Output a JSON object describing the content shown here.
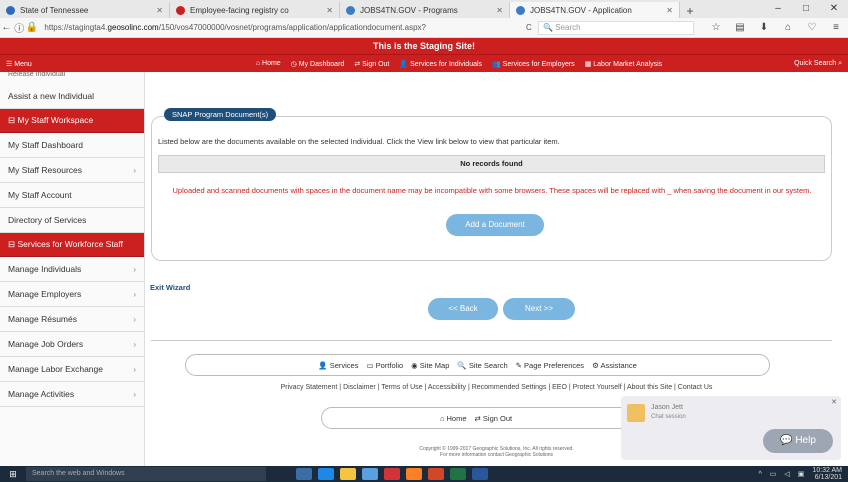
{
  "browser": {
    "tabs": [
      {
        "label": "State of Tennessee",
        "color": "#2d6db5",
        "active": false
      },
      {
        "label": "Employee-facing registry co",
        "color": "#cc1f1f",
        "active": false
      },
      {
        "label": "JOBS4TN.GOV - Programs",
        "color": "#3c7cc4",
        "active": false
      },
      {
        "label": "JOBS4TN.GOV - Application",
        "color": "#3c7cc4",
        "active": true
      }
    ],
    "new_tab": "+",
    "url_prefix": "https://stagingta4.",
    "url_domain": "geosolinc.com",
    "url_path": "/150/vos47000000/vosnet/programs/application/applicationdocument.aspx?",
    "search_placeholder": "Search"
  },
  "banner": {
    "staging_text": "This is the Staging Site!",
    "menu_label": "Menu",
    "nav": [
      "Home",
      "My Dashboard",
      "Sign Out",
      "Services for Individuals",
      "Services for Employers",
      "Labor Market Analysis"
    ],
    "quick_search": "Quick Search"
  },
  "sidebar": {
    "cut_item": "Release Individual",
    "items_top": [
      "Assist a new Individual"
    ],
    "head1": "My Staff Workspace",
    "items_mid": [
      {
        "label": "My Staff Dashboard",
        "chev": false
      },
      {
        "label": "My Staff Resources",
        "chev": true
      },
      {
        "label": "My Staff Account",
        "chev": false
      },
      {
        "label": "Directory of Services",
        "chev": false
      }
    ],
    "head2": "Services for Workforce Staff",
    "items_bottom": [
      {
        "label": "Manage Individuals",
        "chev": true
      },
      {
        "label": "Manage Employers",
        "chev": true
      },
      {
        "label": "Manage Résumés",
        "chev": true
      },
      {
        "label": "Manage Job Orders",
        "chev": true
      },
      {
        "label": "Manage Labor Exchange",
        "chev": true
      },
      {
        "label": "Manage Activities",
        "chev": true
      }
    ]
  },
  "main": {
    "panel_label": "SNAP Program Document(s)",
    "intro": "Listed below are the documents available on the selected Individual. Click the View link below to view that particular item.",
    "no_records": "No records found",
    "warning": "Uploaded and scanned documents with spaces in the document name may be incompatible with some browsers. These spaces will be replaced with _ when saving the document in our system.",
    "add_document": "Add a Document",
    "exit_wizard": "Exit Wizard",
    "back": "<< Back",
    "next": "Next >>"
  },
  "footer": {
    "bar1": [
      "Services",
      "Portfolio",
      "Site Map",
      "Site Search",
      "Page Preferences",
      "Assistance"
    ],
    "links": "Privacy Statement | Disclaimer | Terms of Use | Accessibility | Recommended Settings | EEO | Protect Yourself | About this Site | Contact Us",
    "bar2": [
      "Home",
      "Sign Out"
    ],
    "copyright1": "Copyright © 1999-2017 Geographic Solutions, Inc. All rights reserved.",
    "copyright2": "For more information contact Geographic Solutions"
  },
  "chat": {
    "name": "Jason Jett",
    "status": "Chat session",
    "help": "Help"
  },
  "taskbar": {
    "search": "Search the web and Windows",
    "time": "10:32 AM",
    "date": "6/13/201"
  }
}
